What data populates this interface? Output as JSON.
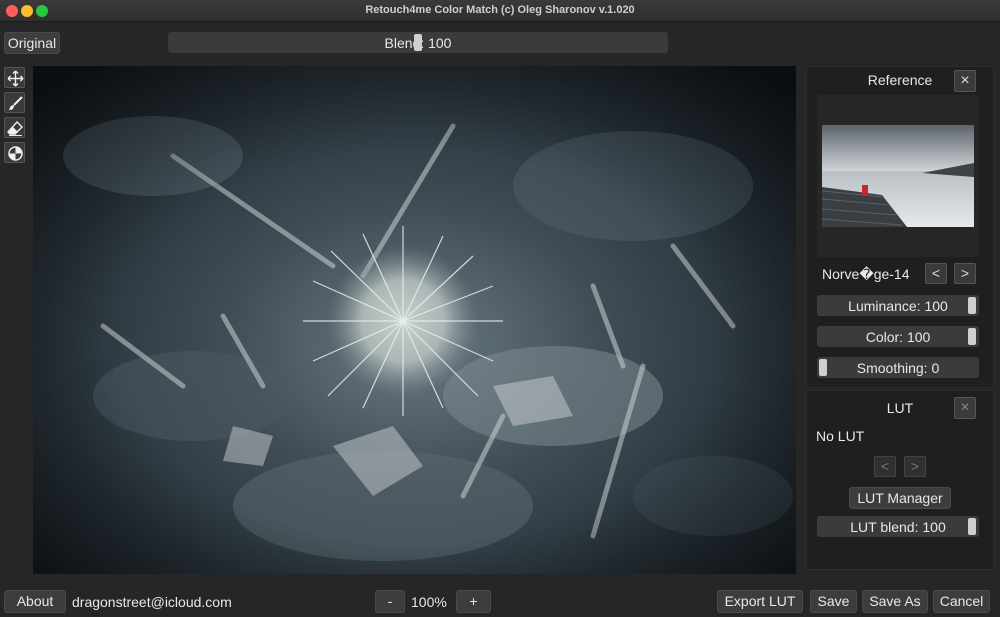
{
  "window": {
    "title": "Retouch4me Color Match (c) Oleg Sharonov v.1.020"
  },
  "toolbar": {
    "original_label": "Original",
    "blend_label": "Blend: 100",
    "blend_value": 100
  },
  "tools": [
    "move-tool",
    "brush-tool",
    "eraser-tool",
    "color-picker-tool"
  ],
  "reference": {
    "title": "Reference",
    "name": "Norve�ge-14",
    "prev": "<",
    "next": ">",
    "close": "×"
  },
  "sliders": {
    "luminance": {
      "label": "Luminance: 100",
      "value": 100
    },
    "color": {
      "label": "Color: 100",
      "value": 100
    },
    "smoothing": {
      "label": "Smoothing: 0",
      "value": 0
    }
  },
  "lut": {
    "title": "LUT",
    "close": "×",
    "status": "No LUT",
    "prev": "<",
    "next": ">",
    "manager_label": "LUT Manager",
    "blend": {
      "label": "LUT blend: 100",
      "value": 100
    }
  },
  "footer": {
    "about": "About",
    "email": "dragonstreet@icloud.com",
    "zoom_out": "-",
    "zoom": "100%",
    "zoom_in": "+",
    "export_lut": "Export LUT",
    "save": "Save",
    "save_as": "Save As",
    "cancel": "Cancel"
  },
  "colors": {
    "background": "#262626",
    "panel": "#1f1f1f",
    "button": "#3d3d3d",
    "photo_tint": "#4f6470"
  }
}
